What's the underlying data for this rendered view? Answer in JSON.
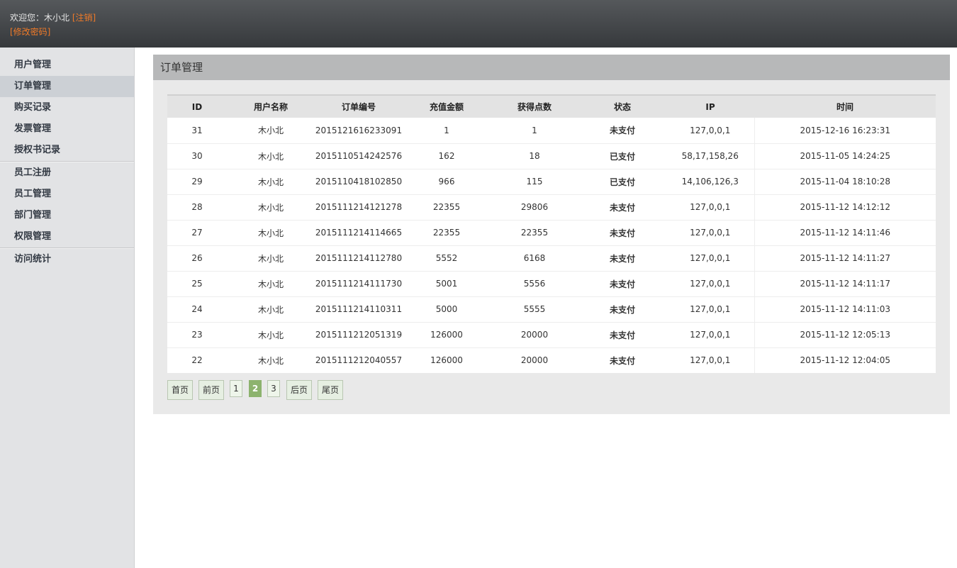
{
  "header": {
    "welcome_prefix": "欢迎您：",
    "username": "木小北",
    "logout": "[注销]",
    "change_password": "[修改密码]"
  },
  "sidebar": {
    "items": [
      {
        "label": "用户管理"
      },
      {
        "label": "订单管理",
        "active": true
      },
      {
        "label": "购买记录"
      },
      {
        "label": "发票管理"
      },
      {
        "label": "授权书记录"
      },
      {
        "label": "员工注册"
      },
      {
        "label": "员工管理"
      },
      {
        "label": "部门管理"
      },
      {
        "label": "权限管理"
      },
      {
        "label": "访问统计"
      }
    ]
  },
  "panel": {
    "title": "订单管理"
  },
  "table": {
    "columns": [
      "ID",
      "用户名称",
      "订单编号",
      "充值金额",
      "获得点数",
      "状态",
      "IP",
      "时间"
    ],
    "rows": [
      [
        "31",
        "木小北",
        "2015121616233091",
        "1",
        "1",
        "未支付",
        "127,0,0,1",
        "2015-12-16 16:23:31"
      ],
      [
        "30",
        "木小北",
        "2015110514242576",
        "162",
        "18",
        "已支付",
        "58,17,158,26",
        "2015-11-05 14:24:25"
      ],
      [
        "29",
        "木小北",
        "2015110418102850",
        "966",
        "115",
        "已支付",
        "14,106,126,3",
        "2015-11-04 18:10:28"
      ],
      [
        "28",
        "木小北",
        "2015111214121278",
        "22355",
        "29806",
        "未支付",
        "127,0,0,1",
        "2015-11-12 14:12:12"
      ],
      [
        "27",
        "木小北",
        "2015111214114665",
        "22355",
        "22355",
        "未支付",
        "127,0,0,1",
        "2015-11-12 14:11:46"
      ],
      [
        "26",
        "木小北",
        "2015111214112780",
        "5552",
        "6168",
        "未支付",
        "127,0,0,1",
        "2015-11-12 14:11:27"
      ],
      [
        "25",
        "木小北",
        "2015111214111730",
        "5001",
        "5556",
        "未支付",
        "127,0,0,1",
        "2015-11-12 14:11:17"
      ],
      [
        "24",
        "木小北",
        "2015111214110311",
        "5000",
        "5555",
        "未支付",
        "127,0,0,1",
        "2015-11-12 14:11:03"
      ],
      [
        "23",
        "木小北",
        "2015111212051319",
        "126000",
        "20000",
        "未支付",
        "127,0,0,1",
        "2015-11-12 12:05:13"
      ],
      [
        "22",
        "木小北",
        "2015111212040557",
        "126000",
        "20000",
        "未支付",
        "127,0,0,1",
        "2015-11-12 12:04:05"
      ]
    ]
  },
  "pager": {
    "first": "首页",
    "prev": "前页",
    "pages": [
      "1",
      "2",
      "3"
    ],
    "current": "2",
    "next": "后页",
    "last": "尾页"
  },
  "colors": {
    "accent_orange": "#f07a28",
    "unpaid": "#dd1111",
    "paid": "#1a7a1a",
    "pager_current": "#8db36e"
  }
}
